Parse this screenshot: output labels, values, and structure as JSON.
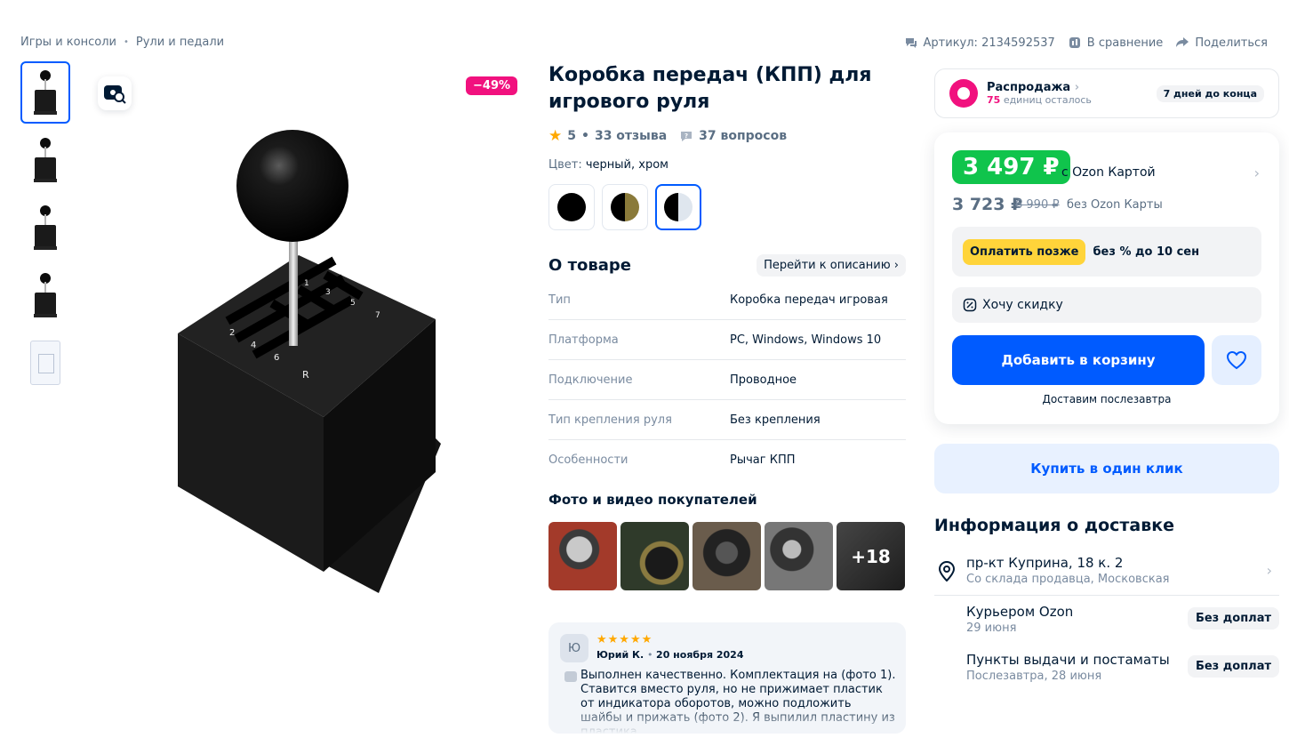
{
  "breadcrumb": {
    "items": [
      "Игры и консоли",
      "Рули и педали"
    ],
    "separator": "•"
  },
  "top_actions": {
    "article": "Артикул: 2134592537",
    "compare": "В сравнение",
    "share": "Поделиться"
  },
  "gallery": {
    "discount": "−49%",
    "thumbnail_count": 5
  },
  "product": {
    "title": "Коробка передач (КПП) для игрового руля",
    "rating": "5",
    "reviews": "33 отзыва",
    "questions": "37 вопросов",
    "color_label": "Цвет:",
    "color_value": "черный, хром",
    "swatch_colors": [
      "#000000",
      "#8a7a3a",
      "#dfe6ee"
    ]
  },
  "about": {
    "title": "О товаре",
    "link": "Перейти к описанию",
    "specs": [
      {
        "k": "Тип",
        "v": "Коробка передач игровая"
      },
      {
        "k": "Платформа",
        "v": "PC, Windows, Windows 10"
      },
      {
        "k": "Подключение",
        "v": "Проводное"
      },
      {
        "k": "Тип крепления руля",
        "v": "Без крепления"
      },
      {
        "k": "Особенности",
        "v": "Рычаг КПП"
      }
    ]
  },
  "customer_photos": {
    "title": "Фото и видео покупателей",
    "more": "+18"
  },
  "review": {
    "initial": "Ю",
    "stars": "★★★★★",
    "author": "Юрий К.",
    "date": "20 ноября 2024",
    "text": "Выполнен качественно. Комплектация на (фото 1). Ставится вместо руля, но не прижимает пластик от индикатора оборотов, можно подложить шайбы и прижать (фото 2). Я выпилил пластину из пластика,"
  },
  "sale": {
    "title": "Распродажа",
    "remaining_count": "75",
    "remaining_text": "единиц осталось",
    "badge": "7 дней до конца"
  },
  "price": {
    "card_price": "3 497 ₽",
    "card_label": "с Ozon Картой",
    "regular_price": "3 723 ₽",
    "old_price": "6 990 ₽",
    "regular_label": "без Ozon Карты",
    "paylater_btn": "Оплатить позже",
    "paylater_text": "без % до 10 сен",
    "want_discount": "Хочу скидку",
    "add_to_cart": "Добавить в корзину",
    "deliver_note": "Доставим послезавтра"
  },
  "oneclick": "Купить в один клик",
  "delivery": {
    "title": "Информация о доставке",
    "address": "пр-кт Куприна, 18 к. 2",
    "address_sub": "Со склада продавца, Московская",
    "options": [
      {
        "name": "Курьером Ozon",
        "date": "29 июня",
        "badge": "Без доплат"
      },
      {
        "name": "Пункты выдачи и постаматы",
        "date": "Послезавтра, 28 июня",
        "badge": "Без доплат"
      }
    ]
  },
  "colors": {
    "accent": "#005bff",
    "sale_pink": "#f1117e",
    "price_green": "#10c44c",
    "paylater_yellow": "#ffd43a"
  }
}
